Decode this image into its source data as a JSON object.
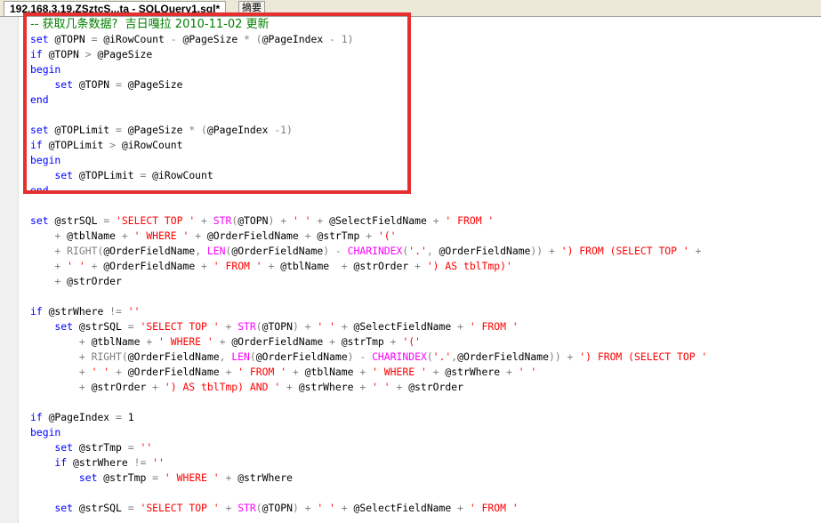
{
  "tab": {
    "title": "192.168.3.19.ZSztcS...ta - SQLQuery1.sql*",
    "extra": "摘要"
  },
  "annotation": {
    "color": "#e53030"
  },
  "colors": {
    "keyword": "#0000ff",
    "function": "#ff00ff",
    "string": "#ff0000",
    "operator": "#808080",
    "comment": "#008000"
  },
  "code_lines": [
    [
      {
        "t": "-- 获取几条数据?  吉日嘎拉 2010-11-02 更新",
        "k": "cm"
      }
    ],
    [
      {
        "t": "set ",
        "k": "kw"
      },
      {
        "t": "@TOPN ",
        "k": "id"
      },
      {
        "t": "= ",
        "k": "op"
      },
      {
        "t": "@iRowCount ",
        "k": "id"
      },
      {
        "t": "- ",
        "k": "op"
      },
      {
        "t": "@PageSize ",
        "k": "id"
      },
      {
        "t": "* (",
        "k": "op"
      },
      {
        "t": "@PageIndex ",
        "k": "id"
      },
      {
        "t": "- 1)",
        "k": "op"
      }
    ],
    [
      {
        "t": "if ",
        "k": "kw"
      },
      {
        "t": "@TOPN ",
        "k": "id"
      },
      {
        "t": "> ",
        "k": "op"
      },
      {
        "t": "@PageSize",
        "k": "id"
      }
    ],
    [
      {
        "t": "begin",
        "k": "kw"
      }
    ],
    [
      {
        "t": "    set ",
        "k": "kw"
      },
      {
        "t": "@TOPN ",
        "k": "id"
      },
      {
        "t": "= ",
        "k": "op"
      },
      {
        "t": "@PageSize",
        "k": "id"
      }
    ],
    [
      {
        "t": "end",
        "k": "kw"
      }
    ],
    [],
    [
      {
        "t": "set ",
        "k": "kw"
      },
      {
        "t": "@TOPLimit ",
        "k": "id"
      },
      {
        "t": "= ",
        "k": "op"
      },
      {
        "t": "@PageSize ",
        "k": "id"
      },
      {
        "t": "* (",
        "k": "op"
      },
      {
        "t": "@PageIndex ",
        "k": "id"
      },
      {
        "t": "-1)",
        "k": "op"
      }
    ],
    [
      {
        "t": "if ",
        "k": "kw"
      },
      {
        "t": "@TOPLimit ",
        "k": "id"
      },
      {
        "t": "> ",
        "k": "op"
      },
      {
        "t": "@iRowCount",
        "k": "id"
      }
    ],
    [
      {
        "t": "begin",
        "k": "kw"
      }
    ],
    [
      {
        "t": "    set ",
        "k": "kw"
      },
      {
        "t": "@TOPLimit ",
        "k": "id"
      },
      {
        "t": "= ",
        "k": "op"
      },
      {
        "t": "@iRowCount",
        "k": "id"
      }
    ],
    [
      {
        "t": "end",
        "k": "kw"
      }
    ],
    [],
    [
      {
        "t": "set ",
        "k": "kw"
      },
      {
        "t": "@strSQL ",
        "k": "id"
      },
      {
        "t": "= ",
        "k": "op"
      },
      {
        "t": "'SELECT TOP ' ",
        "k": "str"
      },
      {
        "t": "+ ",
        "k": "op"
      },
      {
        "t": "STR",
        "k": "fn"
      },
      {
        "t": "(",
        "k": "op"
      },
      {
        "t": "@TOPN",
        "k": "id"
      },
      {
        "t": ") + ",
        "k": "op"
      },
      {
        "t": "' ' ",
        "k": "str"
      },
      {
        "t": "+ ",
        "k": "op"
      },
      {
        "t": "@SelectFieldName ",
        "k": "id"
      },
      {
        "t": "+ ",
        "k": "op"
      },
      {
        "t": "' FROM '",
        "k": "str"
      }
    ],
    [
      {
        "t": "    + ",
        "k": "op"
      },
      {
        "t": "@tblName ",
        "k": "id"
      },
      {
        "t": "+ ",
        "k": "op"
      },
      {
        "t": "' WHERE ' ",
        "k": "str"
      },
      {
        "t": "+ ",
        "k": "op"
      },
      {
        "t": "@OrderFieldName ",
        "k": "id"
      },
      {
        "t": "+ ",
        "k": "op"
      },
      {
        "t": "@strTmp ",
        "k": "id"
      },
      {
        "t": "+ ",
        "k": "op"
      },
      {
        "t": "'('",
        "k": "str"
      }
    ],
    [
      {
        "t": "    + ",
        "k": "op"
      },
      {
        "t": "RIGHT",
        "k": "op"
      },
      {
        "t": "(",
        "k": "op"
      },
      {
        "t": "@OrderFieldName",
        "k": "id"
      },
      {
        "t": ", ",
        "k": "op"
      },
      {
        "t": "LEN",
        "k": "fn"
      },
      {
        "t": "(",
        "k": "op"
      },
      {
        "t": "@OrderFieldName",
        "k": "id"
      },
      {
        "t": ") - ",
        "k": "op"
      },
      {
        "t": "CHARINDEX",
        "k": "fn"
      },
      {
        "t": "(",
        "k": "op"
      },
      {
        "t": "'.'",
        "k": "str"
      },
      {
        "t": ", ",
        "k": "op"
      },
      {
        "t": "@OrderFieldName",
        "k": "id"
      },
      {
        "t": ")) + ",
        "k": "op"
      },
      {
        "t": "') FROM (SELECT TOP ' ",
        "k": "str"
      },
      {
        "t": "+",
        "k": "op"
      }
    ],
    [
      {
        "t": "    + ",
        "k": "op"
      },
      {
        "t": "' ' ",
        "k": "str"
      },
      {
        "t": "+ ",
        "k": "op"
      },
      {
        "t": "@OrderFieldName ",
        "k": "id"
      },
      {
        "t": "+ ",
        "k": "op"
      },
      {
        "t": "' FROM ' ",
        "k": "str"
      },
      {
        "t": "+ ",
        "k": "op"
      },
      {
        "t": "@tblName  ",
        "k": "id"
      },
      {
        "t": "+ ",
        "k": "op"
      },
      {
        "t": "@strOrder ",
        "k": "id"
      },
      {
        "t": "+ ",
        "k": "op"
      },
      {
        "t": "') AS tblTmp)'",
        "k": "str"
      }
    ],
    [
      {
        "t": "    + ",
        "k": "op"
      },
      {
        "t": "@strOrder",
        "k": "id"
      }
    ],
    [],
    [
      {
        "t": "if ",
        "k": "kw"
      },
      {
        "t": "@strWhere ",
        "k": "id"
      },
      {
        "t": "!= ",
        "k": "op"
      },
      {
        "t": "''",
        "k": "str"
      }
    ],
    [
      {
        "t": "    set ",
        "k": "kw"
      },
      {
        "t": "@strSQL ",
        "k": "id"
      },
      {
        "t": "= ",
        "k": "op"
      },
      {
        "t": "'SELECT TOP ' ",
        "k": "str"
      },
      {
        "t": "+ ",
        "k": "op"
      },
      {
        "t": "STR",
        "k": "fn"
      },
      {
        "t": "(",
        "k": "op"
      },
      {
        "t": "@TOPN",
        "k": "id"
      },
      {
        "t": ") + ",
        "k": "op"
      },
      {
        "t": "' ' ",
        "k": "str"
      },
      {
        "t": "+ ",
        "k": "op"
      },
      {
        "t": "@SelectFieldName ",
        "k": "id"
      },
      {
        "t": "+ ",
        "k": "op"
      },
      {
        "t": "' FROM '",
        "k": "str"
      }
    ],
    [
      {
        "t": "        + ",
        "k": "op"
      },
      {
        "t": "@tblName ",
        "k": "id"
      },
      {
        "t": "+ ",
        "k": "op"
      },
      {
        "t": "' WHERE ' ",
        "k": "str"
      },
      {
        "t": "+ ",
        "k": "op"
      },
      {
        "t": "@OrderFieldName ",
        "k": "id"
      },
      {
        "t": "+ ",
        "k": "op"
      },
      {
        "t": "@strTmp ",
        "k": "id"
      },
      {
        "t": "+ ",
        "k": "op"
      },
      {
        "t": "'('",
        "k": "str"
      }
    ],
    [
      {
        "t": "        + ",
        "k": "op"
      },
      {
        "t": "RIGHT",
        "k": "op"
      },
      {
        "t": "(",
        "k": "op"
      },
      {
        "t": "@OrderFieldName",
        "k": "id"
      },
      {
        "t": ", ",
        "k": "op"
      },
      {
        "t": "LEN",
        "k": "fn"
      },
      {
        "t": "(",
        "k": "op"
      },
      {
        "t": "@OrderFieldName",
        "k": "id"
      },
      {
        "t": ") - ",
        "k": "op"
      },
      {
        "t": "CHARINDEX",
        "k": "fn"
      },
      {
        "t": "(",
        "k": "op"
      },
      {
        "t": "'.'",
        "k": "str"
      },
      {
        "t": ",",
        "k": "op"
      },
      {
        "t": "@OrderFieldName",
        "k": "id"
      },
      {
        "t": ")) + ",
        "k": "op"
      },
      {
        "t": "') FROM (SELECT TOP '",
        "k": "str"
      }
    ],
    [
      {
        "t": "        + ",
        "k": "op"
      },
      {
        "t": "' ' ",
        "k": "str"
      },
      {
        "t": "+ ",
        "k": "op"
      },
      {
        "t": "@OrderFieldName ",
        "k": "id"
      },
      {
        "t": "+ ",
        "k": "op"
      },
      {
        "t": "' FROM ' ",
        "k": "str"
      },
      {
        "t": "+ ",
        "k": "op"
      },
      {
        "t": "@tblName ",
        "k": "id"
      },
      {
        "t": "+ ",
        "k": "op"
      },
      {
        "t": "' WHERE ' ",
        "k": "str"
      },
      {
        "t": "+ ",
        "k": "op"
      },
      {
        "t": "@strWhere ",
        "k": "id"
      },
      {
        "t": "+ ",
        "k": "op"
      },
      {
        "t": "' '",
        "k": "str"
      }
    ],
    [
      {
        "t": "        + ",
        "k": "op"
      },
      {
        "t": "@strOrder ",
        "k": "id"
      },
      {
        "t": "+ ",
        "k": "op"
      },
      {
        "t": "') AS tblTmp) AND ' ",
        "k": "str"
      },
      {
        "t": "+ ",
        "k": "op"
      },
      {
        "t": "@strWhere ",
        "k": "id"
      },
      {
        "t": "+ ",
        "k": "op"
      },
      {
        "t": "' ' ",
        "k": "str"
      },
      {
        "t": "+ ",
        "k": "op"
      },
      {
        "t": "@strOrder",
        "k": "id"
      }
    ],
    [],
    [
      {
        "t": "if ",
        "k": "kw"
      },
      {
        "t": "@PageIndex ",
        "k": "id"
      },
      {
        "t": "= ",
        "k": "op"
      },
      {
        "t": "1",
        "k": "id"
      }
    ],
    [
      {
        "t": "begin",
        "k": "kw"
      }
    ],
    [
      {
        "t": "    set ",
        "k": "kw"
      },
      {
        "t": "@strTmp ",
        "k": "id"
      },
      {
        "t": "= ",
        "k": "op"
      },
      {
        "t": "''",
        "k": "str"
      }
    ],
    [
      {
        "t": "    if ",
        "k": "kw"
      },
      {
        "t": "@strWhere ",
        "k": "id"
      },
      {
        "t": "!= ",
        "k": "op"
      },
      {
        "t": "''",
        "k": "str"
      }
    ],
    [
      {
        "t": "        set ",
        "k": "kw"
      },
      {
        "t": "@strTmp ",
        "k": "id"
      },
      {
        "t": "= ",
        "k": "op"
      },
      {
        "t": "' WHERE ' ",
        "k": "str"
      },
      {
        "t": "+ ",
        "k": "op"
      },
      {
        "t": "@strWhere",
        "k": "id"
      }
    ],
    [],
    [
      {
        "t": "    set ",
        "k": "kw"
      },
      {
        "t": "@strSQL ",
        "k": "id"
      },
      {
        "t": "= ",
        "k": "op"
      },
      {
        "t": "'SELECT TOP ' ",
        "k": "str"
      },
      {
        "t": "+ ",
        "k": "op"
      },
      {
        "t": "STR",
        "k": "fn"
      },
      {
        "t": "(",
        "k": "op"
      },
      {
        "t": "@TOPN",
        "k": "id"
      },
      {
        "t": ") + ",
        "k": "op"
      },
      {
        "t": "' ' ",
        "k": "str"
      },
      {
        "t": "+ ",
        "k": "op"
      },
      {
        "t": "@SelectFieldName ",
        "k": "id"
      },
      {
        "t": "+ ",
        "k": "op"
      },
      {
        "t": "' FROM '",
        "k": "str"
      }
    ]
  ]
}
